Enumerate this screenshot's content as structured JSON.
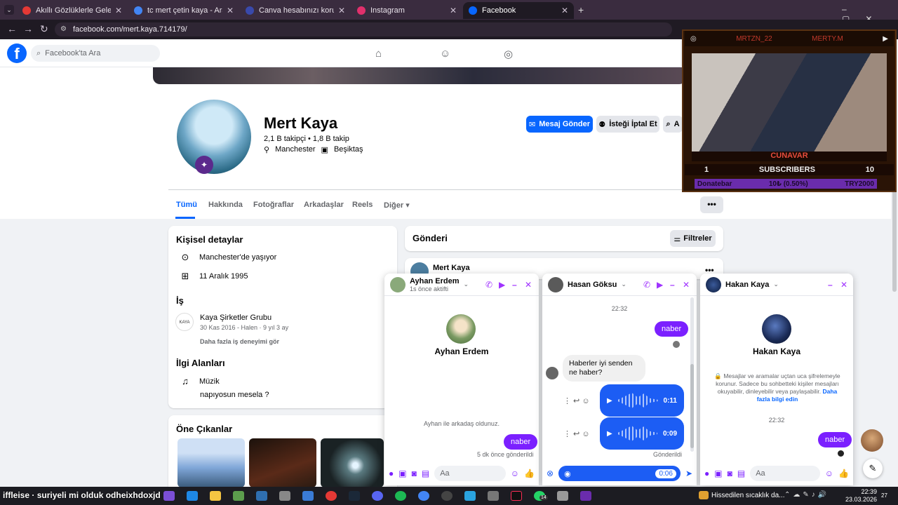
{
  "browser": {
    "tabs": [
      {
        "label": "Akıllı Gözlüklerle Geleceği G",
        "favicon_color": "#e53935"
      },
      {
        "label": "tc mert çetin kaya - Arama Son",
        "favicon_color": "#4285f4"
      },
      {
        "label": "Canva hesabınızı koruyun",
        "favicon_color": "#3949ab"
      },
      {
        "label": "Instagram",
        "favicon_color": "#e1306c"
      },
      {
        "label": "Facebook",
        "favicon_color": "#0866ff"
      }
    ],
    "new_tab": "+",
    "url": "facebook.com/mert.kaya.714179/"
  },
  "fb": {
    "logo": "f",
    "search_placeholder": "Facebook'ta Ara"
  },
  "profile": {
    "name": "Mert Kaya",
    "stats": "2,1 B takipçi • 1,8 B takip",
    "location": "Manchester",
    "team": "Beşiktaş",
    "message_button": "Mesaj Gönder",
    "unfollow_button": "İsteği İptal Et",
    "search_button": "A",
    "tabs": [
      "Tümü",
      "Hakkında",
      "Fotoğraflar",
      "Arkadaşlar",
      "Reels",
      "Diğer"
    ],
    "more": "•••"
  },
  "details": {
    "title": "Kişisel detaylar",
    "lives": "Manchester'de yaşıyor",
    "birthday": "11 Aralık 1995",
    "work_title": "İş",
    "company": "Kaya Şirketler Grubu",
    "company_dates": "30 Kas 2016 - Halen · 9 yıl 3 ay",
    "more_work": "Daha fazla iş deneyimi gör",
    "interests_title": "İlgi Alanları",
    "music_label": "Müzik",
    "music_value": "napıyosun mesela ?",
    "highlights_title": "Öne Çıkanlar"
  },
  "posts": {
    "title": "Gönderi",
    "filter_button": "Filtreler",
    "first_author": "Mert Kaya"
  },
  "chats": [
    {
      "name": "Ayhan Erdem",
      "status": "1s önce aktifti",
      "friend_note": "Ayhan ile arkadaş oldunuz.",
      "sent_message": "naber",
      "sent_meta": "5 dk önce gönderildi",
      "input_placeholder": "Aa"
    },
    {
      "name": "Hasan Göksu",
      "time": "22:32",
      "sent_message": "naber",
      "received_message": "Haberler iyi senden ne haber?",
      "voice1": "0:11",
      "voice2": "0:09",
      "sent_status": "Gönderildi",
      "recording_time": "0:06"
    },
    {
      "name": "Hakan Kaya",
      "encryption_note": "Mesajlar ve aramalar uçtan uca şifrelemeyle korunur. Sadece bu sohbetteki kişiler mesajları okuyabilir, dinleyebilir veya paylaşabilir.",
      "learn_more": "Daha fazla bilgi edin",
      "time": "22:32",
      "sent_message": "naber",
      "input_placeholder": "Aa"
    }
  ],
  "stream": {
    "left_handle": "MRTZN_22",
    "right_handle": "MERTY.M",
    "cam_label": "CUNAVAR",
    "subs_current": "1",
    "subs_label": "SUBSCRIBERS",
    "subs_goal": "10",
    "donate_left": "Donatebar",
    "donate_mid": "10₺ (0.50%)",
    "donate_right": "TRY2000",
    "overlay_text_1": "iffleise",
    "overlay_text_2": "suriyeli mi olduk odheixhdoxjd"
  },
  "taskbar": {
    "weather": "Hissedilen sıcaklık da...",
    "time": "22:39",
    "date": "23.03.2026",
    "notif": "27",
    "badge": "14"
  }
}
